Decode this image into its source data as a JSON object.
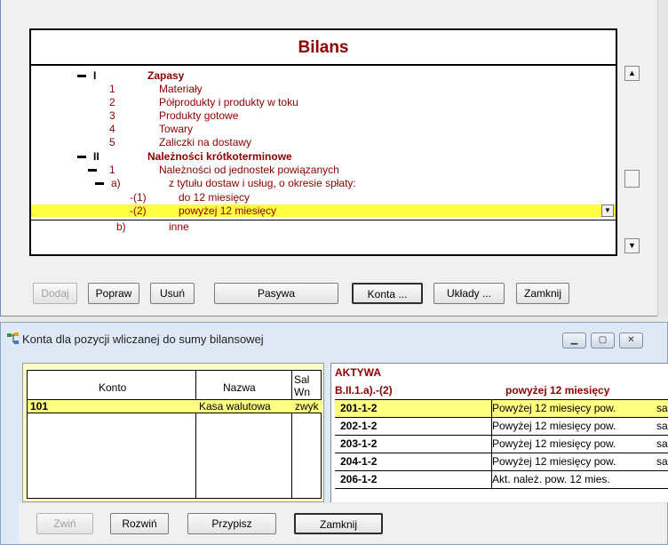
{
  "bilans": {
    "title": "Bilans",
    "rows": [
      {
        "num": "I",
        "label": "Zapasy",
        "bold": true
      },
      {
        "num": "1",
        "label": "Materiały"
      },
      {
        "num": "2",
        "label": "Półprodukty i produkty w toku"
      },
      {
        "num": "3",
        "label": "Produkty gotowe"
      },
      {
        "num": "4",
        "label": "Towary"
      },
      {
        "num": "5",
        "label": "Zaliczki na dostawy"
      },
      {
        "num": "II",
        "label": "Należności krótkoterminowe",
        "bold": true
      },
      {
        "num": "1",
        "label": "Należności od jednostek powiązanych"
      },
      {
        "num": "a)",
        "label": "z tytułu dostaw i usług, o okresie spłaty:"
      },
      {
        "num": "-(1)",
        "label": "do 12 miesięcy"
      },
      {
        "num": "-(2)",
        "label": "powyżej 12 miesięcy",
        "selected": true
      },
      {
        "num": "b)",
        "label": "inne"
      }
    ]
  },
  "top_buttons": {
    "dodaj": "Dodaj",
    "popraw": "Popraw",
    "usun": "Usuń",
    "pasywa": "Pasywa",
    "konta": "Konta ...",
    "uklady": "Układy ...",
    "zamknij": "Zamknij"
  },
  "lower_window": {
    "title": "Konta dla pozycji wliczanej do sumy bilansowej",
    "icon": "tree-accounts-icon",
    "left_table": {
      "headers": {
        "konto": "Konto",
        "nazwa": "Nazwa",
        "saldo_1": "Sal",
        "saldo_2": "Wn"
      },
      "rows": [
        {
          "konto": "101",
          "nazwa": "Kasa walutowa",
          "saldo": "zwyk"
        }
      ]
    },
    "right_panel": {
      "header_1": "AKTYWA",
      "code": "B.II.1.a).-(2)",
      "name": "powyżej 12 miesięcy",
      "rows": [
        {
          "code": "201-1-2",
          "desc": "Powyżej 12 miesięcy pow.",
          "more": "sa"
        },
        {
          "code": "202-1-2",
          "desc": "Powyżej 12 miesięcy pow.",
          "more": "sa"
        },
        {
          "code": "203-1-2",
          "desc": "Powyżej 12 miesięcy pow.",
          "more": "sa"
        },
        {
          "code": "204-1-2",
          "desc": "Powyżej 12 miesięcy pow.",
          "more": "sa"
        },
        {
          "code": "206-1-2",
          "desc": "Akt. należ. pow. 12 mies.",
          "more": ""
        }
      ]
    },
    "buttons": {
      "zwin": "Zwiń",
      "rozwin": "Rozwiń",
      "przypisz": "Przypisz",
      "zamknij": "Zamknij"
    }
  },
  "colors": {
    "title_red": "#8b0000",
    "highlight_yellow": "#ffff40",
    "panel_cream": "#ffffc6"
  }
}
